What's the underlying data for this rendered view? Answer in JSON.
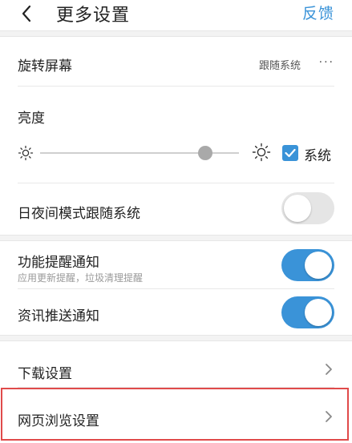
{
  "header": {
    "title": "更多设置",
    "feedback_label": "反馈"
  },
  "rotate": {
    "label": "旋转屏幕",
    "value": "跟随系统",
    "more": "···"
  },
  "brightness": {
    "label": "亮度",
    "level": 0.83,
    "system_checked": true,
    "system_label": "系统"
  },
  "night_mode": {
    "label": "日夜间模式跟随系统",
    "on": false
  },
  "feature_notify": {
    "label": "功能提醒通知",
    "sub": "应用更新提醒，垃圾清理提醒",
    "on": true
  },
  "news_push": {
    "label": "资讯推送通知",
    "on": true
  },
  "download": {
    "label": "下载设置"
  },
  "web_browse": {
    "label": "网页浏览设置"
  },
  "colors": {
    "accent": "#3a93d8",
    "highlight": "#e04a4a"
  }
}
